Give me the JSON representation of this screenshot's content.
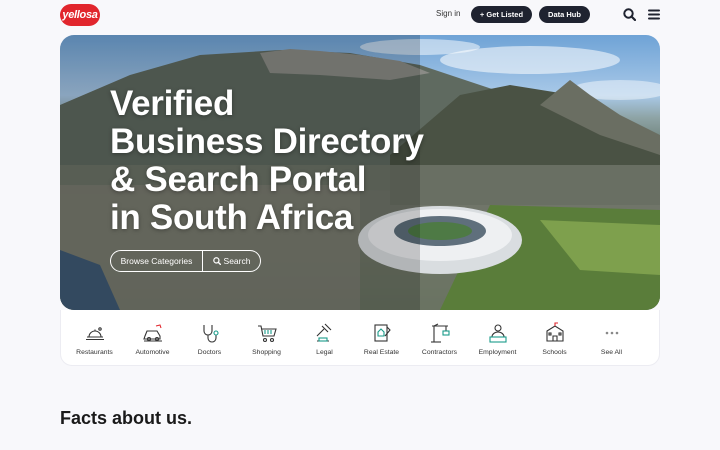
{
  "header": {
    "logo_text": "yellosa",
    "signin": "Sign in",
    "get_listed": "+ Get Listed",
    "data_hub": "Data Hub"
  },
  "hero": {
    "title_lines": [
      "Verified",
      "Business Directory",
      "& Search Portal",
      "in South Africa"
    ],
    "browse_label": "Browse Categories",
    "search_label": "Search"
  },
  "categories": [
    {
      "label": "Restaurants",
      "icon": "restaurant-icon"
    },
    {
      "label": "Automotive",
      "icon": "automotive-icon"
    },
    {
      "label": "Doctors",
      "icon": "stethoscope-icon"
    },
    {
      "label": "Shopping",
      "icon": "shopping-cart-icon"
    },
    {
      "label": "Legal",
      "icon": "gavel-icon"
    },
    {
      "label": "Real Estate",
      "icon": "real-estate-icon"
    },
    {
      "label": "Contractors",
      "icon": "crane-icon"
    },
    {
      "label": "Employment",
      "icon": "employment-icon"
    },
    {
      "label": "Schools",
      "icon": "school-icon"
    },
    {
      "label": "See All",
      "icon": "more-icon"
    }
  ],
  "facts_heading": "Facts about us.",
  "colors": {
    "brand": "#e1262d",
    "dark_button": "#1f2330",
    "page_bg": "#f8f8fb"
  }
}
